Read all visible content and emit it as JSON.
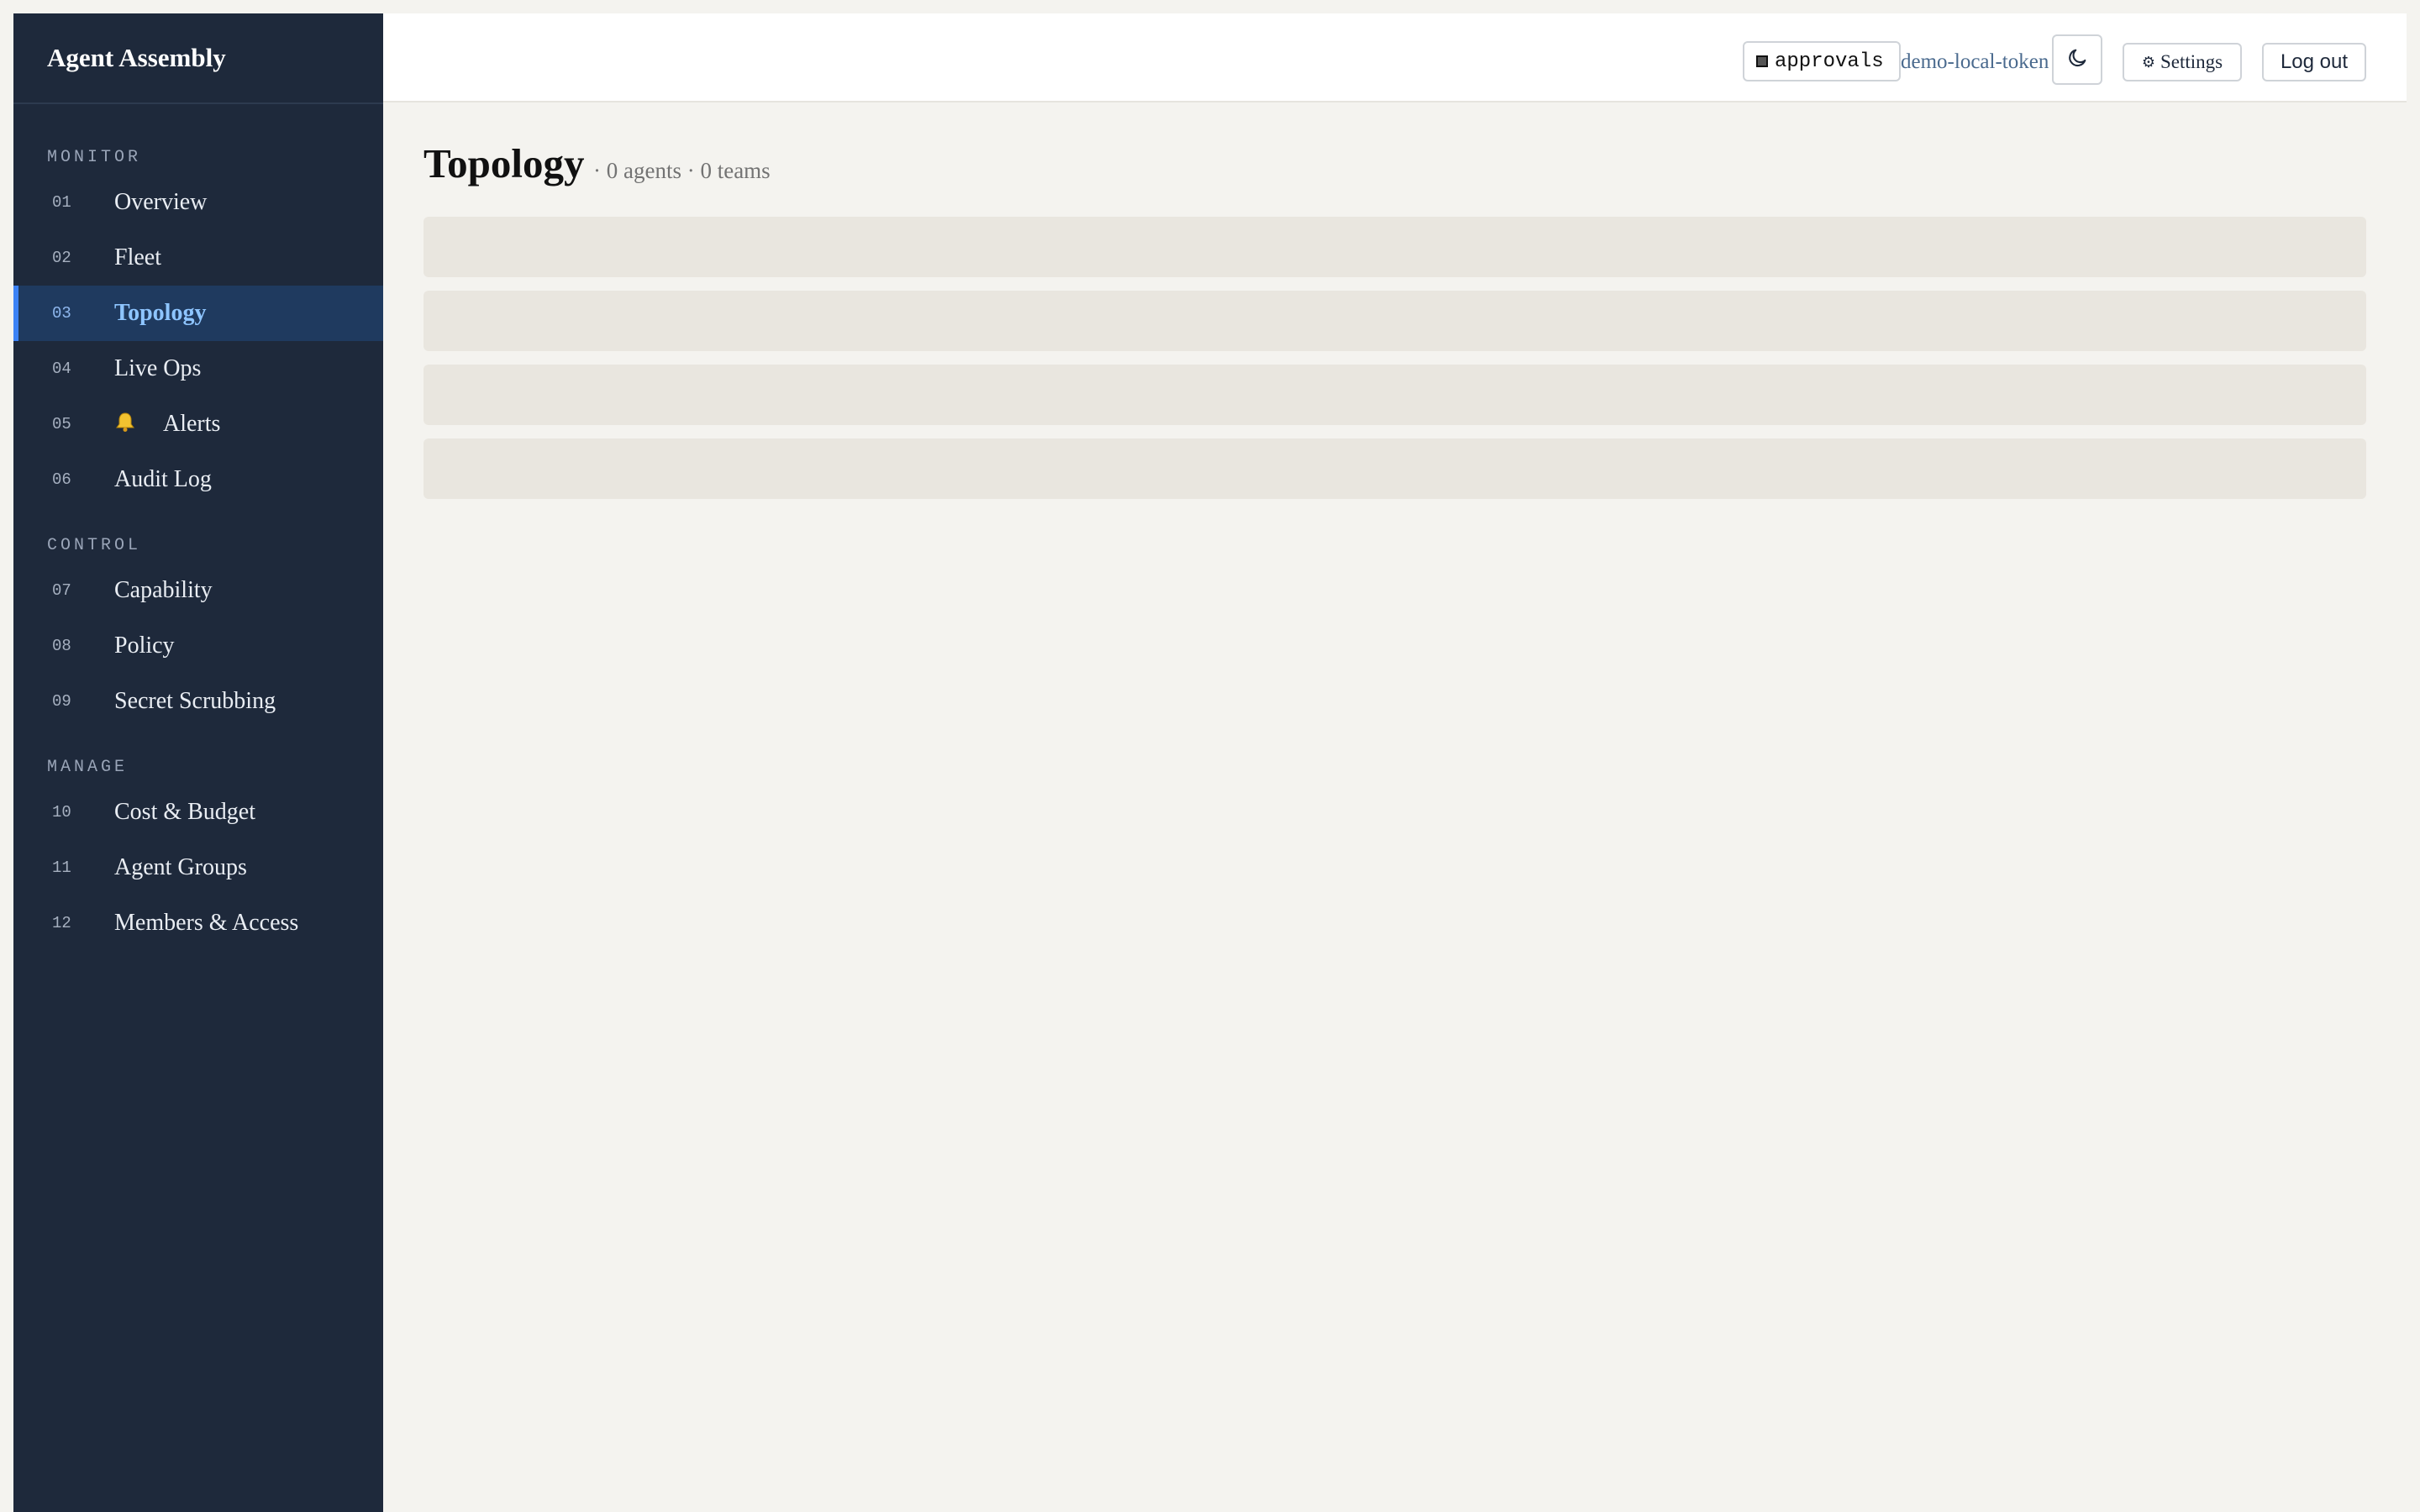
{
  "app": {
    "title": "Agent Assembly"
  },
  "sidebar": {
    "sections": [
      {
        "label": "MONITOR",
        "items": [
          {
            "num": "01",
            "label": "Overview"
          },
          {
            "num": "02",
            "label": "Fleet"
          },
          {
            "num": "03",
            "label": "Topology",
            "active": true
          },
          {
            "num": "04",
            "label": "Live Ops"
          },
          {
            "num": "05",
            "label": "Alerts",
            "icon": "bell-icon"
          },
          {
            "num": "06",
            "label": "Audit Log"
          }
        ]
      },
      {
        "label": "CONTROL",
        "items": [
          {
            "num": "07",
            "label": "Capability"
          },
          {
            "num": "08",
            "label": "Policy"
          },
          {
            "num": "09",
            "label": "Secret Scrubbing"
          }
        ]
      },
      {
        "label": "MANAGE",
        "items": [
          {
            "num": "10",
            "label": "Cost & Budget"
          },
          {
            "num": "11",
            "label": "Agent Groups"
          },
          {
            "num": "12",
            "label": "Members & Access"
          }
        ]
      }
    ]
  },
  "header": {
    "approvals_label": "approvals",
    "token": "demo-local-token",
    "theme_icon": "moon-icon",
    "settings_icon": "⚙",
    "settings_label": "Settings",
    "logout_label": "Log out"
  },
  "main": {
    "title": "Topology",
    "subtitle": "· 0 agents · 0 teams"
  },
  "colors": {
    "sidebar_bg": "#1e293b",
    "active_bg": "#1f3a5f",
    "accent": "#3b82f6",
    "page_bg": "#f4f3ef",
    "skeleton": "#e9e6df"
  }
}
